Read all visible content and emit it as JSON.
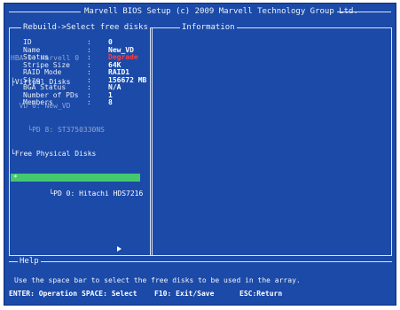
{
  "window": {
    "title": "Marvell BIOS Setup (c) 2009 Marvell Technology Group Ltd."
  },
  "left_panel": {
    "title": "Rebuild->Select free disks",
    "tree": [
      {
        "text": "HBA 0: Marvell 0",
        "style": "dim"
      },
      {
        "text": "├Virtual Disks",
        "style": "bright"
      },
      {
        "text": "  VD 0: New_VD",
        "style": "dim"
      },
      {
        "text": "    └PD 8: ST3750330NS",
        "style": "dim"
      },
      {
        "text": "└Free Physical Disks",
        "style": "bright"
      },
      {
        "text": "   └PD 0: Hitachi HDS7216",
        "style": "selected",
        "marker": "*"
      }
    ]
  },
  "right_panel": {
    "title": "Information",
    "rows": [
      {
        "key": "ID",
        "sep": ":",
        "value": "0"
      },
      {
        "key": "Name",
        "sep": ":",
        "value": "New_VD"
      },
      {
        "key": "Status",
        "sep": ":",
        "value": "Degrade",
        "accent": "#ff3d3d"
      },
      {
        "key": "Stripe Size",
        "sep": ":",
        "value": "64K"
      },
      {
        "key": "RAID Mode",
        "sep": ":",
        "value": "RAID1"
      },
      {
        "key": "Size",
        "sep": ":",
        "value": "156672 MB"
      },
      {
        "key": "BGA Status",
        "sep": ":",
        "value": "N/A"
      },
      {
        "key": "Number of PDs",
        "sep": ":",
        "value": "1"
      },
      {
        "key": "Members",
        "sep": ":",
        "value": "8"
      }
    ]
  },
  "help": {
    "title": "Help",
    "text": "Use the space bar to select the free disks to be used in the array.",
    "keys": [
      "ENTER: Operation",
      "SPACE: Select",
      "F10: Exit/Save",
      "ESC:Return"
    ]
  },
  "colors": {
    "background": "#1b4aa8",
    "selection": "#45c96e",
    "status": "#ff3d3d",
    "text": "#e9eef8"
  },
  "icons": {
    "scroll_indicator": "right-arrow-icon"
  }
}
